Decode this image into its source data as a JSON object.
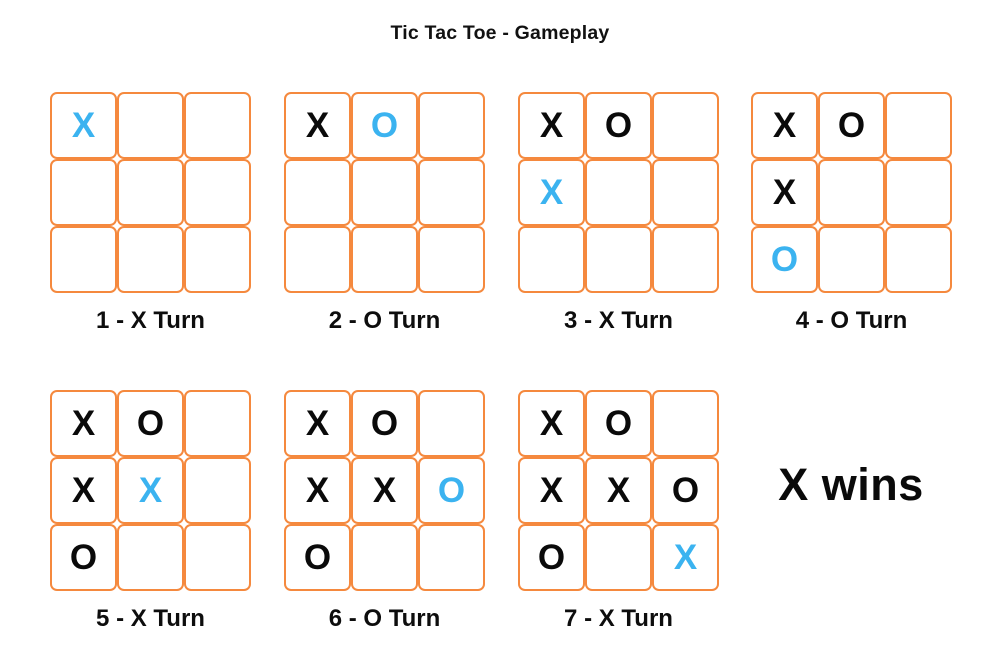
{
  "page": {
    "title": "Tic Tac Toe - Gameplay",
    "background_color": "#ffffff"
  },
  "colors": {
    "grid_border": "#f5893e",
    "mark_previous": "#0a0a0a",
    "mark_latest": "#3bb3f0",
    "text": "#0d0d0d"
  },
  "result": {
    "text": "X wins",
    "winner": "X",
    "winning_line": "diagonal-top-left-to-bottom-right"
  },
  "boards": [
    {
      "id": "board-1",
      "label": "1 - X Turn",
      "move_number": 1,
      "player": "X",
      "latest_move": [
        0,
        0
      ],
      "cells": [
        [
          {
            "mark": "X",
            "state": "new"
          },
          {
            "mark": "",
            "state": "empty"
          },
          {
            "mark": "",
            "state": "empty"
          }
        ],
        [
          {
            "mark": "",
            "state": "empty"
          },
          {
            "mark": "",
            "state": "empty"
          },
          {
            "mark": "",
            "state": "empty"
          }
        ],
        [
          {
            "mark": "",
            "state": "empty"
          },
          {
            "mark": "",
            "state": "empty"
          },
          {
            "mark": "",
            "state": "empty"
          }
        ]
      ]
    },
    {
      "id": "board-2",
      "label": "2 - O Turn",
      "move_number": 2,
      "player": "O",
      "latest_move": [
        0,
        1
      ],
      "cells": [
        [
          {
            "mark": "X",
            "state": "old"
          },
          {
            "mark": "O",
            "state": "new"
          },
          {
            "mark": "",
            "state": "empty"
          }
        ],
        [
          {
            "mark": "",
            "state": "empty"
          },
          {
            "mark": "",
            "state": "empty"
          },
          {
            "mark": "",
            "state": "empty"
          }
        ],
        [
          {
            "mark": "",
            "state": "empty"
          },
          {
            "mark": "",
            "state": "empty"
          },
          {
            "mark": "",
            "state": "empty"
          }
        ]
      ]
    },
    {
      "id": "board-3",
      "label": "3 - X Turn",
      "move_number": 3,
      "player": "X",
      "latest_move": [
        1,
        0
      ],
      "cells": [
        [
          {
            "mark": "X",
            "state": "old"
          },
          {
            "mark": "O",
            "state": "old"
          },
          {
            "mark": "",
            "state": "empty"
          }
        ],
        [
          {
            "mark": "X",
            "state": "new"
          },
          {
            "mark": "",
            "state": "empty"
          },
          {
            "mark": "",
            "state": "empty"
          }
        ],
        [
          {
            "mark": "",
            "state": "empty"
          },
          {
            "mark": "",
            "state": "empty"
          },
          {
            "mark": "",
            "state": "empty"
          }
        ]
      ]
    },
    {
      "id": "board-4",
      "label": "4 - O Turn",
      "move_number": 4,
      "player": "O",
      "latest_move": [
        2,
        0
      ],
      "cells": [
        [
          {
            "mark": "X",
            "state": "old"
          },
          {
            "mark": "O",
            "state": "old"
          },
          {
            "mark": "",
            "state": "empty"
          }
        ],
        [
          {
            "mark": "X",
            "state": "old"
          },
          {
            "mark": "",
            "state": "empty"
          },
          {
            "mark": "",
            "state": "empty"
          }
        ],
        [
          {
            "mark": "O",
            "state": "new"
          },
          {
            "mark": "",
            "state": "empty"
          },
          {
            "mark": "",
            "state": "empty"
          }
        ]
      ]
    },
    {
      "id": "board-5",
      "label": "5 - X Turn",
      "move_number": 5,
      "player": "X",
      "latest_move": [
        1,
        1
      ],
      "cells": [
        [
          {
            "mark": "X",
            "state": "old"
          },
          {
            "mark": "O",
            "state": "old"
          },
          {
            "mark": "",
            "state": "empty"
          }
        ],
        [
          {
            "mark": "X",
            "state": "old"
          },
          {
            "mark": "X",
            "state": "new"
          },
          {
            "mark": "",
            "state": "empty"
          }
        ],
        [
          {
            "mark": "O",
            "state": "old"
          },
          {
            "mark": "",
            "state": "empty"
          },
          {
            "mark": "",
            "state": "empty"
          }
        ]
      ]
    },
    {
      "id": "board-6",
      "label": "6 - O Turn",
      "move_number": 6,
      "player": "O",
      "latest_move": [
        1,
        2
      ],
      "cells": [
        [
          {
            "mark": "X",
            "state": "old"
          },
          {
            "mark": "O",
            "state": "old"
          },
          {
            "mark": "",
            "state": "empty"
          }
        ],
        [
          {
            "mark": "X",
            "state": "old"
          },
          {
            "mark": "X",
            "state": "old"
          },
          {
            "mark": "O",
            "state": "new"
          }
        ],
        [
          {
            "mark": "O",
            "state": "old"
          },
          {
            "mark": "",
            "state": "empty"
          },
          {
            "mark": "",
            "state": "empty"
          }
        ]
      ]
    },
    {
      "id": "board-7",
      "label": "7 - X Turn",
      "move_number": 7,
      "player": "X",
      "latest_move": [
        2,
        2
      ],
      "cells": [
        [
          {
            "mark": "X",
            "state": "old"
          },
          {
            "mark": "O",
            "state": "old"
          },
          {
            "mark": "",
            "state": "empty"
          }
        ],
        [
          {
            "mark": "X",
            "state": "old"
          },
          {
            "mark": "X",
            "state": "old"
          },
          {
            "mark": "O",
            "state": "old"
          }
        ],
        [
          {
            "mark": "O",
            "state": "old"
          },
          {
            "mark": "",
            "state": "empty"
          },
          {
            "mark": "X",
            "state": "new"
          }
        ]
      ]
    }
  ]
}
